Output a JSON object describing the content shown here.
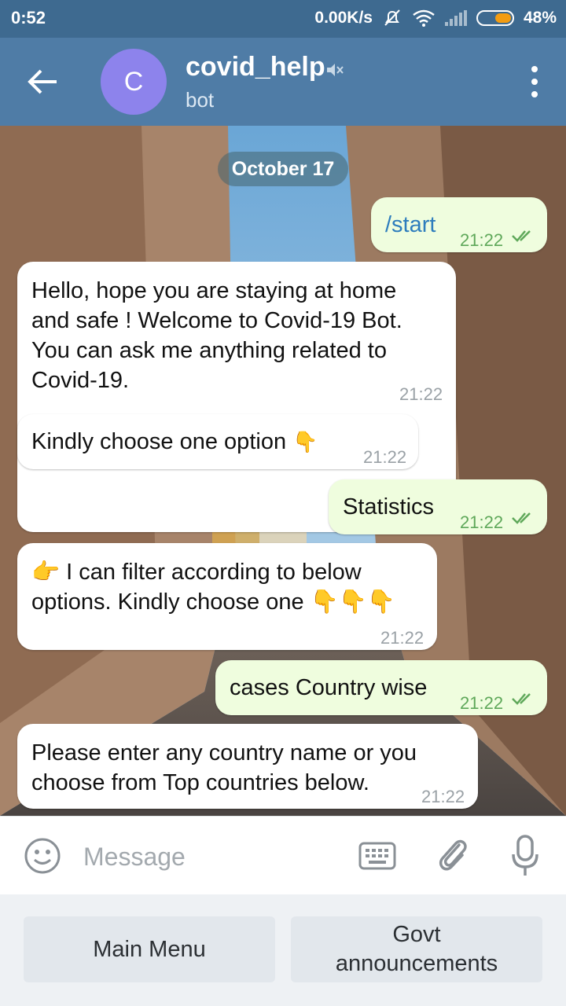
{
  "status_bar": {
    "time": "0:52",
    "net_speed": "0.00K/s",
    "battery": "48%",
    "icons": [
      "bell-off-icon",
      "wifi-icon",
      "signal-icon",
      "battery-icon"
    ]
  },
  "header": {
    "avatar_letter": "C",
    "title": "covid_help",
    "subtitle": "bot",
    "colors": {
      "header": "#4f7ca6",
      "status_bar": "#3e6a90",
      "avatar": "#8d83ec"
    }
  },
  "chat": {
    "date": "October 17",
    "messages": [
      {
        "dir": "out",
        "text": "/start",
        "time": "21:22"
      },
      {
        "dir": "in",
        "lines": [
          "Hello, hope you are staying at home",
          "and safe ! Welcome to Covid-19 Bot.",
          "You can ask me anything related to",
          "Covid-19."
        ],
        "time": "21:22"
      },
      {
        "dir": "in",
        "text": "Kindly choose one option",
        "emoji": "👇",
        "time": "21:22"
      },
      {
        "dir": "out",
        "text": "Statistics",
        "time": "21:22"
      },
      {
        "dir": "in",
        "lines": [
          "👉 I can filter according to below",
          "options. Kindly choose one 👇👇👇"
        ],
        "time": "21:22"
      },
      {
        "dir": "out",
        "text": "cases Country wise",
        "time": "21:22"
      },
      {
        "dir": "in",
        "lines": [
          "Please enter any country name or you",
          "choose from Top countries below."
        ],
        "time": "21:22"
      }
    ],
    "colors": {
      "incoming": "#ffffff",
      "outgoing": "#effdde",
      "out_time": "#5fa85a",
      "command": "#2e7dbd"
    }
  },
  "input": {
    "placeholder": "Message"
  },
  "keyboard": {
    "buttons": [
      {
        "label": "Main Menu"
      },
      {
        "label_lines": [
          "Govt",
          "announcements"
        ]
      }
    ]
  }
}
